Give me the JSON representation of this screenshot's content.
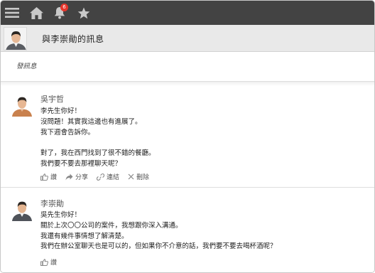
{
  "nav": {
    "icons": [
      "menu-icon",
      "home-icon",
      "bell-icon",
      "star-icon"
    ],
    "notification_count": "6",
    "colors": {
      "bar": "#434343",
      "icon": "#c9c9c9",
      "badge": "#e8352b"
    }
  },
  "header": {
    "title": "與李崇勛的訊息"
  },
  "compose": {
    "label": "發訊息"
  },
  "messages": [
    {
      "sender": "吳宇哲",
      "lines": [
        "李先生你好！",
        "沒問題！其實我這邊也有進展了。",
        "我下週會告訴你。",
        "",
        "對了，我在西門找到了很不錯的餐廳。",
        "我們要不要去那裡聊天呢？"
      ],
      "actions": {
        "like": "讚",
        "share": "分享",
        "link": "連結",
        "delete": "刪除"
      }
    },
    {
      "sender": "李崇勛",
      "lines": [
        "吳先生你好！",
        "關於上次〇〇公司的案件，我想跟你深入溝通。",
        "我還有幾件事情想了解清楚。",
        "我們在辦公室聊天也是可以的，但如果你不介意的話，我們要不要去喝杯酒呢？"
      ],
      "actions": {
        "like": "讚"
      }
    }
  ]
}
